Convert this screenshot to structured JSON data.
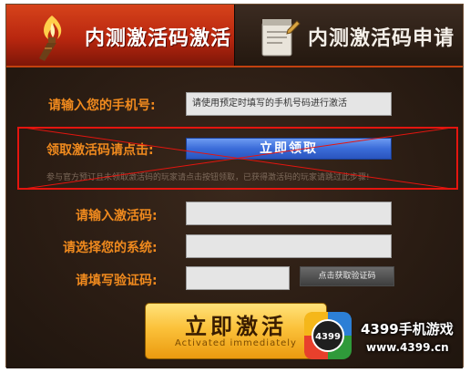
{
  "tabs": {
    "active_label": "内测激活码激活",
    "inactive_label": "内测激活码申请"
  },
  "form": {
    "phone_label": "请输入您的手机号:",
    "phone_placeholder": "请使用预定时填写的手机号码进行激活",
    "claim_label": "领取激活码请点击:",
    "claim_button": "立即领取",
    "hint": "参与官方预订且未领取激活码的玩家请点击按钮领取，已获得激活码的玩家请跳过此步骤!",
    "code_label": "请输入激活码:",
    "system_label": "请选择您的系统:",
    "captcha_label": "请填写验证码:",
    "get_captcha_button": "点击获取验证码",
    "activate_main": "立即激活",
    "activate_sub": "Activated  immediately"
  },
  "watermark": {
    "logo_text": "4399",
    "title": "4399手机游戏",
    "url": "www.4399.cn"
  },
  "colors": {
    "accent_red": "#c2410f",
    "label_orange": "#f08a1e",
    "annotation_red": "#e4150f",
    "button_blue": "#3b6cd9",
    "button_gold": "#fbc13a"
  }
}
